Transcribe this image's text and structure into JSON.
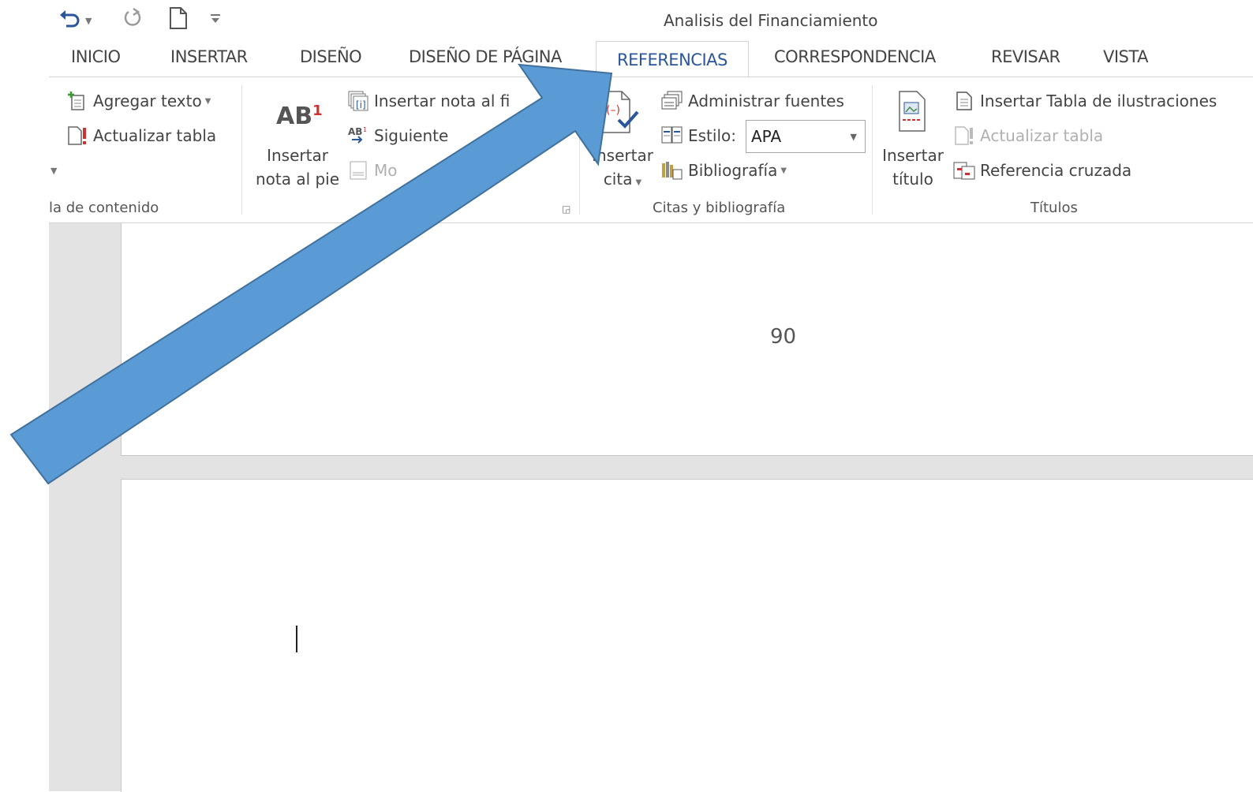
{
  "window": {
    "title": "Analisis del Financiamiento"
  },
  "quick_access": {
    "undo_icon": "undo-icon",
    "redo_icon": "redo-icon",
    "new_document_icon": "new-document-icon",
    "customize_icon": "customize-qat-icon"
  },
  "tabs": [
    {
      "label": "INICIO"
    },
    {
      "label": "INSERTAR"
    },
    {
      "label": "DISEÑO"
    },
    {
      "label": "DISEÑO DE PÁGINA"
    },
    {
      "label": "REFERENCIAS",
      "active": true
    },
    {
      "label": "CORRESPONDENCIA"
    },
    {
      "label": "REVISAR"
    },
    {
      "label": "VISTA"
    }
  ],
  "ribbon": {
    "toc": {
      "add_text": "Agregar texto",
      "update_table": "Actualizar tabla",
      "group_label": "la de contenido"
    },
    "footnotes": {
      "big_icon": "AB",
      "big_icon_superscript": "1",
      "insert_footnote_line1": "Insertar",
      "insert_footnote_line2": "nota al pie",
      "insert_endnote": "Insertar nota al fi",
      "next_footnote": "Siguiente",
      "show_notes": "Mo"
    },
    "citations": {
      "insert_citation_line1": "Insertar",
      "insert_citation_line2": "cita",
      "manage_sources": "Administrar fuentes",
      "style_label": "Estilo:",
      "style_value": "APA",
      "bibliography": "Bibliografía",
      "group_label": "Citas y bibliografía"
    },
    "captions": {
      "insert_caption_line1": "Insertar",
      "insert_caption_line2": "título",
      "insert_table_figures": "Insertar Tabla de ilustraciones",
      "update_table": "Actualizar tabla",
      "cross_reference": "Referencia cruzada",
      "group_label": "Títulos"
    }
  },
  "document": {
    "page_number": "90"
  },
  "annotation": {
    "arrow_color": "#5b9bd5",
    "arrow_stroke": "#41719c"
  },
  "colors": {
    "accent": "#2b579a"
  }
}
